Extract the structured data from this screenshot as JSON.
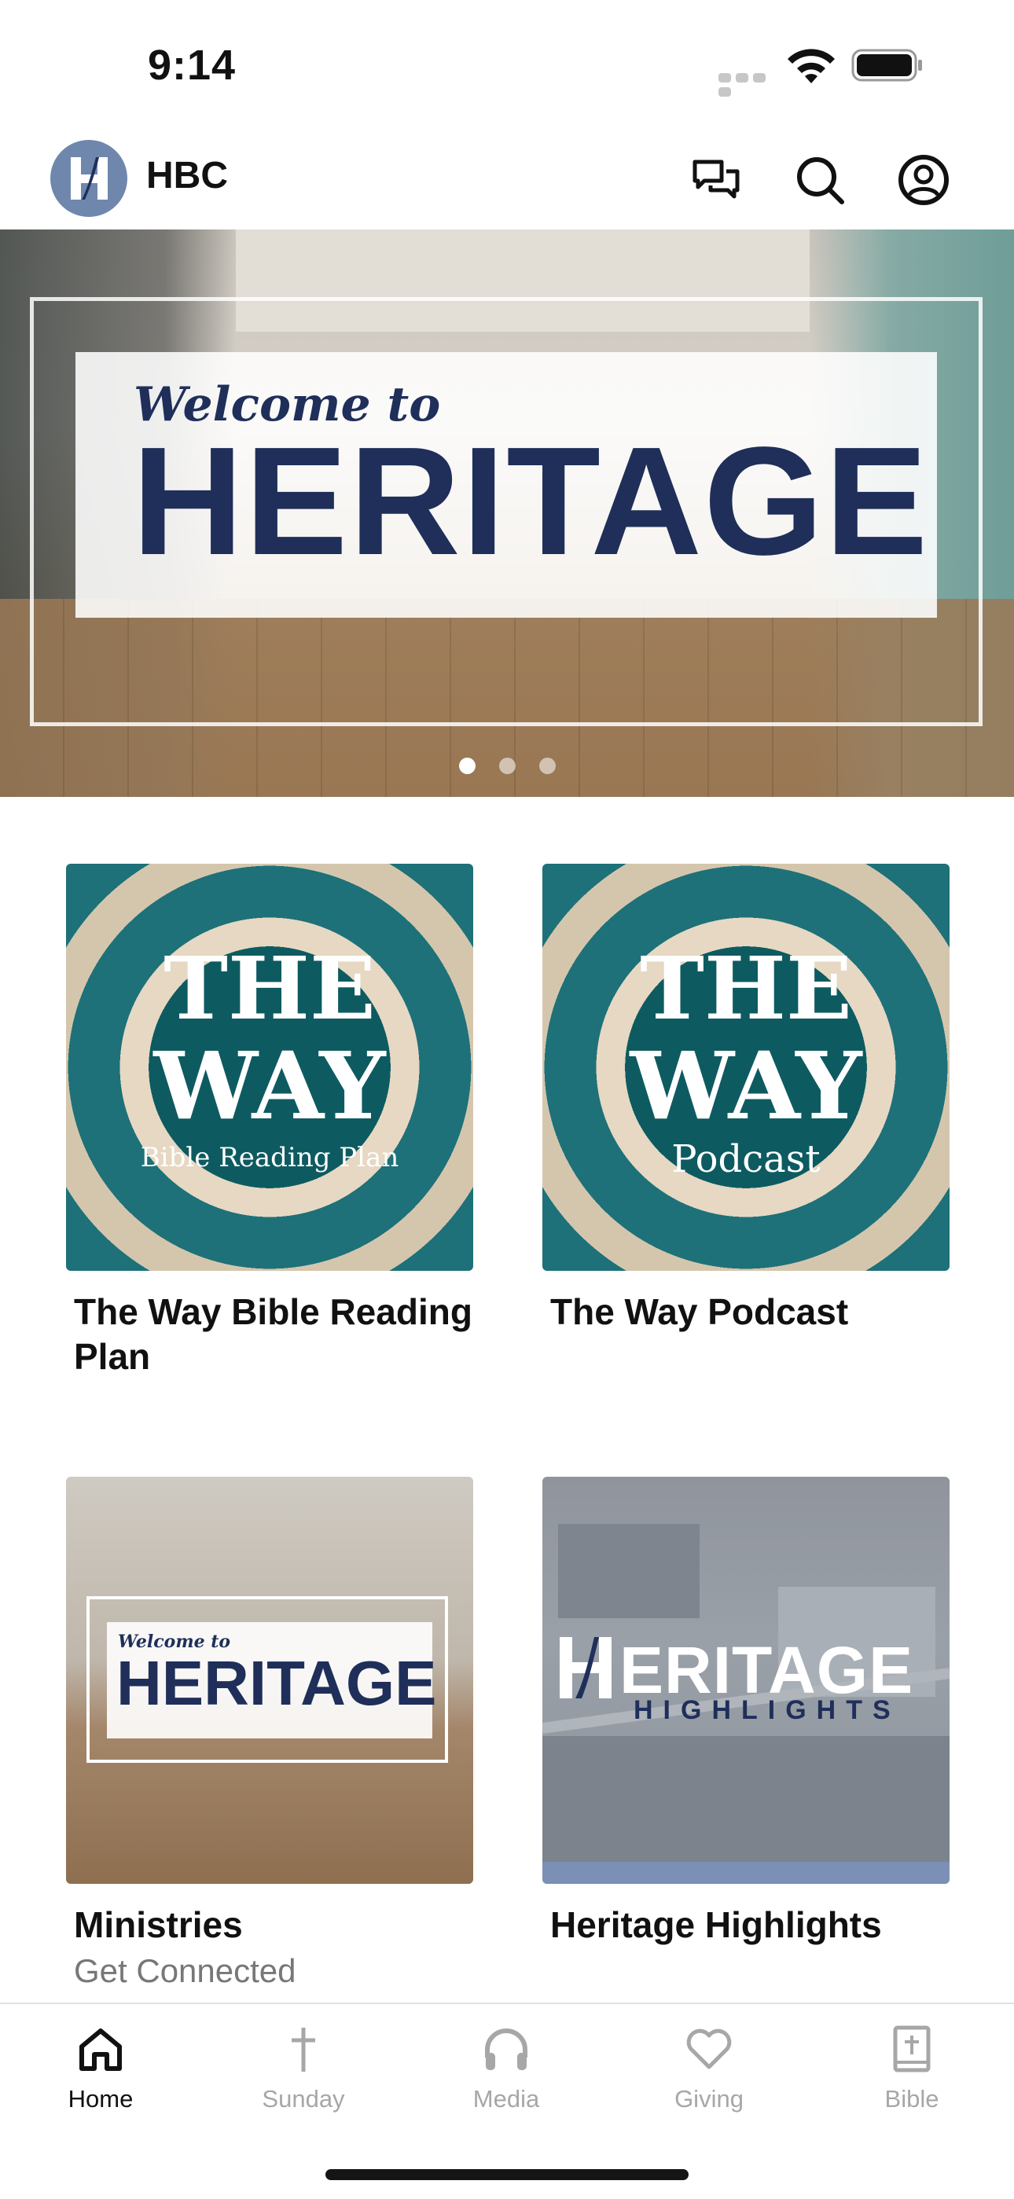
{
  "status_bar": {
    "time": "9:14"
  },
  "header": {
    "title": "HBC"
  },
  "carousel": {
    "kicker": "Welcome to",
    "title": "HERITAGE",
    "page_count": 3,
    "active_index": 0
  },
  "cards": [
    {
      "title": "The Way Bible Reading Plan",
      "subtitle": "",
      "thumb_line1": "THE",
      "thumb_line2": "WAY",
      "thumb_sub": "Bible Reading Plan"
    },
    {
      "title": "The Way Podcast",
      "subtitle": "",
      "thumb_line1": "THE",
      "thumb_line2": "WAY",
      "thumb_sub": "Podcast"
    },
    {
      "title": "Ministries",
      "subtitle": "Get Connected",
      "thumb_kicker": "Welcome to",
      "thumb_title": "HERITAGE"
    },
    {
      "title": "Heritage Highlights",
      "subtitle": "",
      "thumb_title": "ERITAGE",
      "thumb_sub": "HIGHLIGHTS"
    }
  ],
  "tabs": [
    {
      "label": "Home",
      "icon": "home-icon",
      "active": true
    },
    {
      "label": "Sunday",
      "icon": "cross-icon",
      "active": false
    },
    {
      "label": "Media",
      "icon": "headphones-icon",
      "active": false
    },
    {
      "label": "Giving",
      "icon": "heart-icon",
      "active": false
    },
    {
      "label": "Bible",
      "icon": "bible-icon",
      "active": false
    }
  ],
  "colors": {
    "navy": "#1f2f5a",
    "teal": "#0d5b61",
    "logo_bg": "#7087ad"
  }
}
